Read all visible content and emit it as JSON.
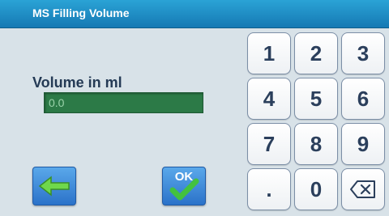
{
  "window": {
    "title": "MS Filling Volume"
  },
  "input": {
    "label": "Volume in ml",
    "value": "0.0"
  },
  "buttons": {
    "ok_label": "OK"
  },
  "keypad": {
    "keys": [
      "1",
      "2",
      "3",
      "4",
      "5",
      "6",
      "7",
      "8",
      "9",
      ".",
      "0"
    ]
  },
  "colors": {
    "titlebar": "#1e8cc8",
    "field_bg": "#2c7a47",
    "button_blue": "#2b72c9",
    "ok_check": "#43c23f",
    "back_arrow": "#6fd84b"
  },
  "icons": {
    "back": "left-arrow-icon",
    "confirm": "checkmark-icon",
    "delete": "backspace-icon"
  }
}
